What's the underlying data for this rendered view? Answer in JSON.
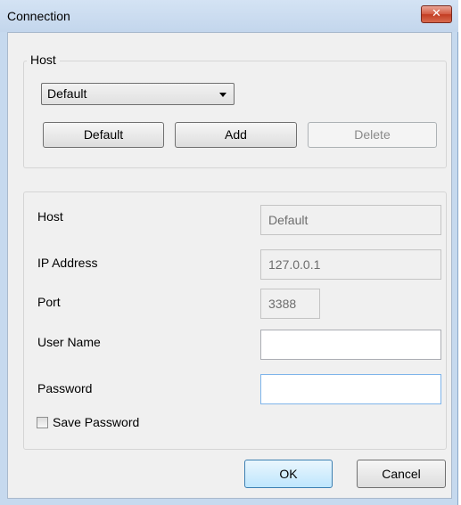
{
  "window": {
    "title": "Connection",
    "close_glyph": "✕"
  },
  "host_group": {
    "legend": "Host",
    "selected_host": "Default",
    "buttons": {
      "default": "Default",
      "add": "Add",
      "delete": "Delete"
    }
  },
  "details": {
    "host_label": "Host",
    "host_value": "Default",
    "ip_label": "IP Address",
    "ip_value": "127.0.0.1",
    "port_label": "Port",
    "port_value": "3388",
    "user_label": "User Name",
    "user_value": "",
    "password_label": "Password",
    "password_value": "",
    "save_password_label": "Save Password",
    "save_password_checked": false
  },
  "footer": {
    "ok": "OK",
    "cancel": "Cancel"
  }
}
